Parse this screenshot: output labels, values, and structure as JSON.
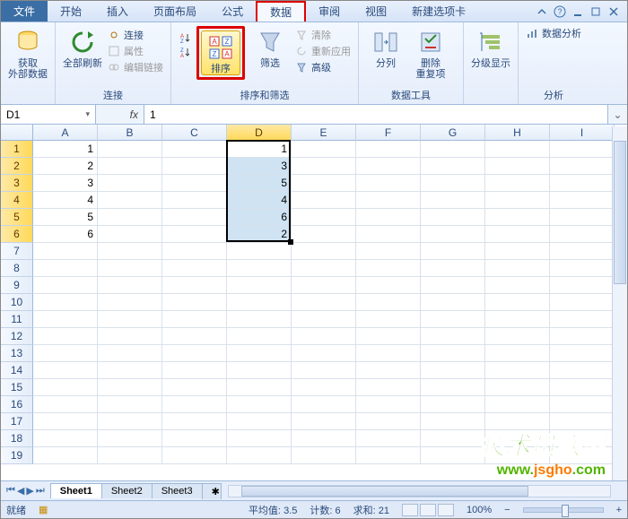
{
  "tabs": {
    "file": "文件",
    "home": "开始",
    "insert": "插入",
    "layout": "页面布局",
    "formula": "公式",
    "data": "数据",
    "review": "审阅",
    "view": "视图",
    "newtab": "新建选项卡"
  },
  "ribbon": {
    "getdata": {
      "label": "获取\n外部数据"
    },
    "refresh": {
      "label": "全部刷新",
      "connect": "连接",
      "props": "属性",
      "editlinks": "编辑链接",
      "group": "连接"
    },
    "sort": {
      "az": "A→Z",
      "za": "Z→A",
      "btn": "排序",
      "filter": "筛选",
      "clear": "清除",
      "reapply": "重新应用",
      "advanced": "高级",
      "group": "排序和筛选"
    },
    "datatools": {
      "texttocol": "分列",
      "dedup": "删除\n重复项",
      "group": "数据工具"
    },
    "outline": {
      "btn": "分级显示",
      "group": "分析"
    },
    "analysis": {
      "btn": "数据分析"
    }
  },
  "namebox": "D1",
  "formula": "1",
  "columns": [
    "A",
    "B",
    "C",
    "D",
    "E",
    "F",
    "G",
    "H",
    "I"
  ],
  "rows_count": 19,
  "selected_col_index": 3,
  "selected_rows": [
    0,
    1,
    2,
    3,
    4,
    5
  ],
  "colA": [
    "1",
    "2",
    "3",
    "4",
    "5",
    "6"
  ],
  "colD": [
    "1",
    "3",
    "5",
    "4",
    "6",
    "2"
  ],
  "sheets": {
    "s1": "Sheet1",
    "s2": "Sheet2",
    "s3": "Sheet3"
  },
  "status": {
    "ready": "就绪",
    "avg_label": "平均值:",
    "avg": "3.5",
    "count_label": "计数:",
    "count": "6",
    "sum_label": "求和:",
    "sum": "21",
    "zoom": "100%"
  },
  "watermark": {
    "line1": "技术员联盟",
    "line2_pre": "www.",
    "line2_mid": "jsgho",
    "line2_post": ".com"
  }
}
